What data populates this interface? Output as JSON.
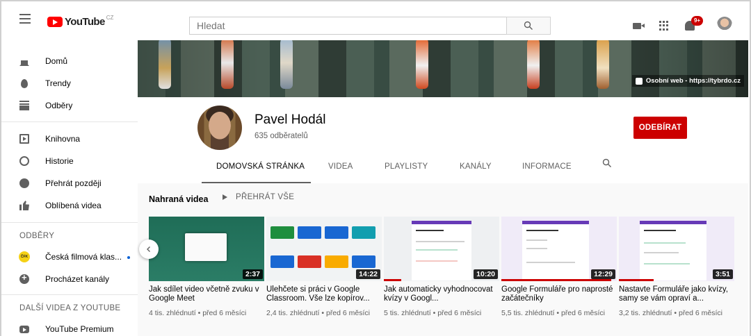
{
  "header": {
    "logo_text": "YouTube",
    "logo_country": "CZ",
    "search_placeholder": "Hledat",
    "notifications_badge": "9+"
  },
  "sidebar": {
    "main": [
      {
        "label": "Domů",
        "icon": "home-icon"
      },
      {
        "label": "Trendy",
        "icon": "trending-icon"
      },
      {
        "label": "Odběry",
        "icon": "subscriptions-icon"
      }
    ],
    "library": [
      {
        "label": "Knihovna",
        "icon": "library-icon"
      },
      {
        "label": "Historie",
        "icon": "history-icon"
      },
      {
        "label": "Přehrát později",
        "icon": "watch-later-icon"
      },
      {
        "label": "Oblíbená videa",
        "icon": "liked-videos-icon"
      }
    ],
    "subscriptions_heading": "ODBĚRY",
    "subscriptions": [
      {
        "label": "Česká filmová klas...",
        "icon": "channel-avatar",
        "new_content": true
      },
      {
        "label": "Procházet kanály",
        "icon": "browse-channels-icon"
      }
    ],
    "more_heading": "DALŠÍ VIDEA Z YOUTUBE",
    "more": [
      {
        "label": "YouTube Premium",
        "icon": "youtube-premium-icon"
      }
    ]
  },
  "channel": {
    "banner_link": "Osobní web - https://tybrdo.cz",
    "name": "Pavel Hodál",
    "subscribers": "635 odběratelů",
    "subscribe_label": "ODEBÍRAT",
    "tabs": [
      "DOMOVSKÁ STRÁNKA",
      "VIDEA",
      "PLAYLISTY",
      "KANÁLY",
      "INFORMACE"
    ],
    "active_tab": "DOMOVSKÁ STRÁNKA"
  },
  "shelf": {
    "title": "Nahraná videa",
    "play_all": "PŘEHRÁT VŠE",
    "videos": [
      {
        "title": "Jak sdílet video včetně zvuku v Google Meet",
        "duration": "2:37",
        "meta": "4 tis. zhlédnutí • před 6 měsíci",
        "watched": 0.0
      },
      {
        "title": "Ulehčete si práci v Google Classroom. Vše lze kopírov...",
        "duration": "14:22",
        "meta": "2,4 tis. zhlédnutí • před 6 měsíci",
        "watched": 0.0
      },
      {
        "title": "Jak automaticky vyhodnocovat kvízy v Googl...",
        "duration": "10:20",
        "meta": "5 tis. zhlédnutí • před 6 měsíci",
        "watched": 0.15
      },
      {
        "title": "Google Formuláře pro naprosté začátečníky",
        "duration": "12:29",
        "meta": "5,5 tis. zhlédnutí • před 6 měsíci",
        "watched": 0.95
      },
      {
        "title": "Nastavte Formuláře jako kvízy, samy se vám opraví a...",
        "duration": "3:51",
        "meta": "3,2 tis. zhlédnutí • před 6 měsíci",
        "watched": 0.3
      }
    ]
  },
  "colors": {
    "brand_red": "#ff0000",
    "subscribe_red": "#cc0000",
    "link_blue": "#065fd4"
  }
}
